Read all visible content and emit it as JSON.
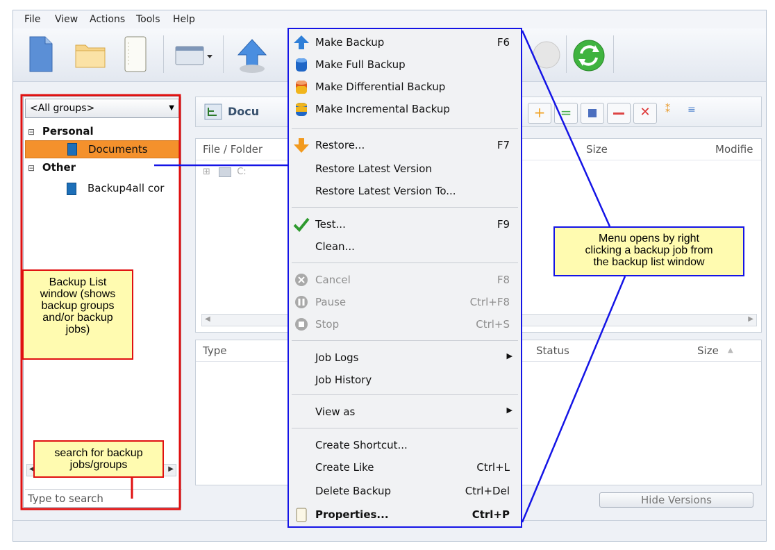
{
  "menubar": {
    "file": "File",
    "view": "View",
    "actions": "Actions",
    "tools": "Tools",
    "help": "Help"
  },
  "left": {
    "group_select": "<All groups>",
    "tree": {
      "personal": "Personal",
      "documents": "Documents",
      "other": "Other",
      "backup4all": "Backup4all cor"
    },
    "search_placeholder": "Type to search"
  },
  "right": {
    "header_title": "Docu",
    "top_columns": {
      "file_folder": "File / Folder",
      "size": "Size",
      "modified": "Modifie"
    },
    "row_c": "C:",
    "bottom_columns": {
      "type": "Type",
      "status": "Status",
      "size": "Size"
    },
    "hide_versions": "Hide Versions"
  },
  "context_menu": {
    "items": [
      {
        "label": "Make Backup",
        "shortcut": "F6"
      },
      {
        "label": "Make Full Backup",
        "shortcut": ""
      },
      {
        "label": "Make Differential Backup",
        "shortcut": ""
      },
      {
        "label": "Make Incremental Backup",
        "shortcut": ""
      },
      {
        "label": "Restore...",
        "shortcut": "F7"
      },
      {
        "label": "Restore Latest Version",
        "shortcut": ""
      },
      {
        "label": "Restore Latest Version To...",
        "shortcut": ""
      },
      {
        "label": "Test...",
        "shortcut": "F9"
      },
      {
        "label": "Clean...",
        "shortcut": ""
      },
      {
        "label": "Cancel",
        "shortcut": "F8"
      },
      {
        "label": "Pause",
        "shortcut": "Ctrl+F8"
      },
      {
        "label": "Stop",
        "shortcut": "Ctrl+S"
      },
      {
        "label": "Job Logs",
        "shortcut": ""
      },
      {
        "label": "Job History",
        "shortcut": ""
      },
      {
        "label": "View as",
        "shortcut": ""
      },
      {
        "label": "Create Shortcut...",
        "shortcut": ""
      },
      {
        "label": "Create Like",
        "shortcut": "Ctrl+L"
      },
      {
        "label": "Delete Backup",
        "shortcut": "Ctrl+Del"
      },
      {
        "label": "Properties...",
        "shortcut": "Ctrl+P"
      }
    ]
  },
  "callouts": {
    "backup_list": [
      "Backup List",
      "window (shows",
      "backup groups",
      "and/or backup",
      "jobs)"
    ],
    "search": [
      "search for backup",
      "jobs/groups"
    ],
    "menu": [
      "Menu opens by right",
      "clicking a backup job from",
      "the backup list window"
    ]
  },
  "colors": {
    "annotation_red": "#e01010",
    "annotation_blue": "#1414e6",
    "callout_fill": "#fffbb0",
    "selection": "#f4912c"
  }
}
